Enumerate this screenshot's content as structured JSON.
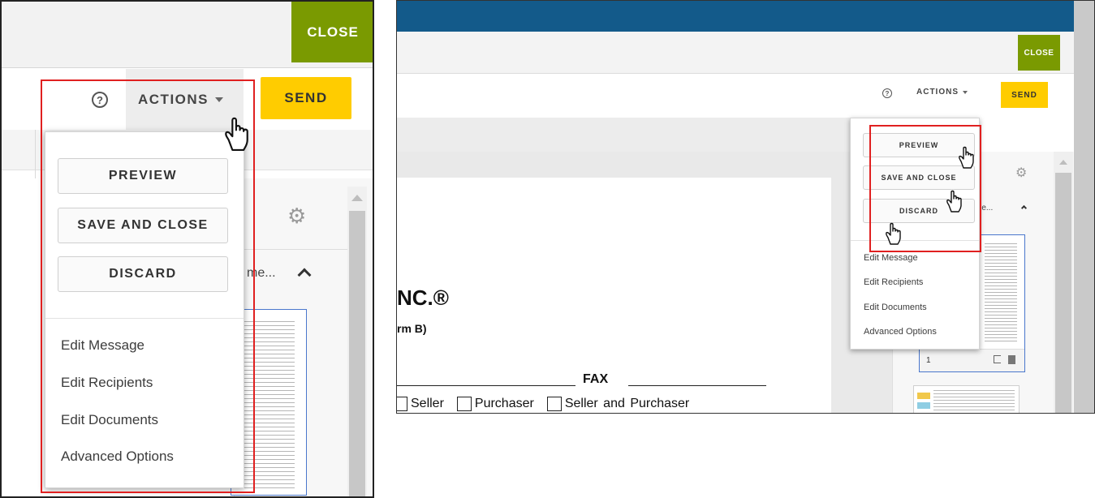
{
  "colors": {
    "close_green": "#7a9a01",
    "send_yellow": "#ffcc00",
    "header_blue": "#135a8a",
    "highlight_red": "#e02020",
    "doc_thumb_border": "#4a77cc"
  },
  "left": {
    "header": {
      "close_label": "CLOSE"
    },
    "toolbar": {
      "help_icon": "help-circle-icon",
      "actions_label": "ACTIONS",
      "send_label": "SEND"
    },
    "menu": {
      "buttons": [
        "PREVIEW",
        "SAVE AND CLOSE",
        "DISCARD"
      ],
      "items": [
        "Edit Message",
        "Edit Recipients",
        "Edit Documents",
        "Advanced Options"
      ]
    },
    "documents_panel": {
      "title_fragment": "me...",
      "settings_icon": "gear-icon",
      "collapse_icon": "chevron-up-icon"
    }
  },
  "right": {
    "header": {
      "close_label": "CLOSE"
    },
    "toolbar": {
      "help_icon": "help-circle-icon",
      "actions_label": "ACTIONS",
      "send_label": "SEND"
    },
    "menu": {
      "buttons": [
        "PREVIEW",
        "SAVE AND CLOSE",
        "DISCARD"
      ],
      "items": [
        "Edit Message",
        "Edit Recipients",
        "Edit Documents",
        "Advanced Options"
      ]
    },
    "document": {
      "line1": "NC.®",
      "line2": "rm B)",
      "fax_label": "FAX",
      "checkboxes": [
        "Seller",
        "Purchaser",
        "Seller and Purchaser"
      ]
    },
    "documents_panel": {
      "title_fragment": "me...",
      "page_number": "1",
      "settings_icon": "gear-icon"
    }
  }
}
